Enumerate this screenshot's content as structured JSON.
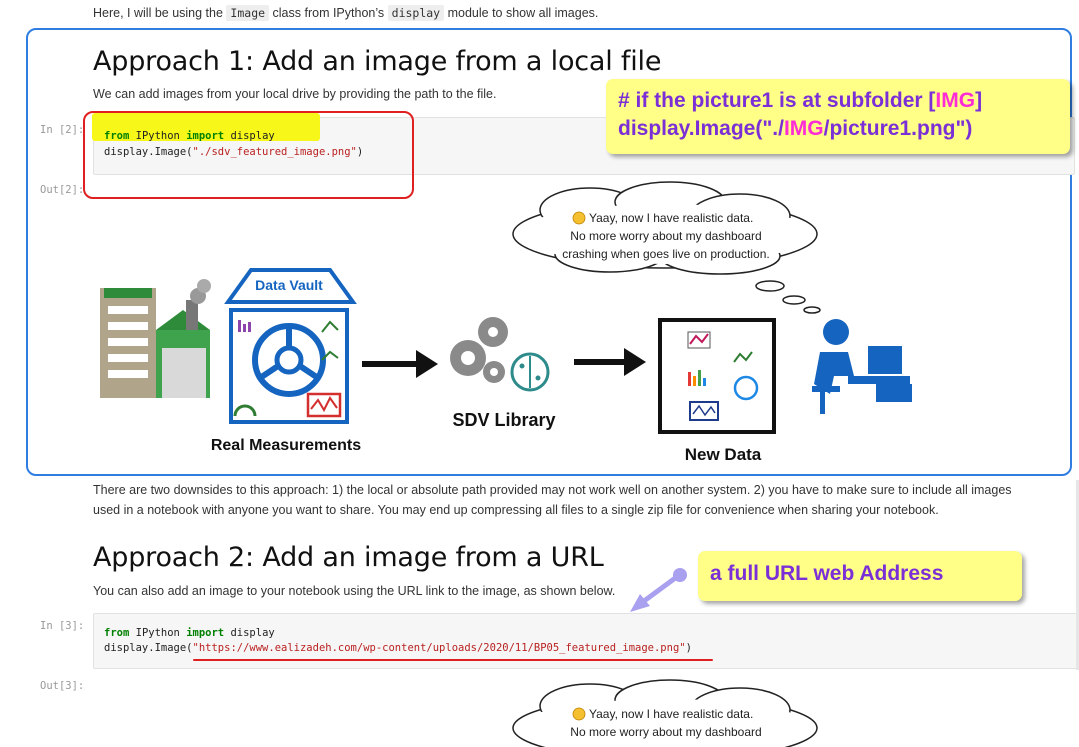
{
  "intro": {
    "before": "Here, I will be using the",
    "code1": "Image",
    "middle": "class from IPython’s",
    "code2": "display",
    "after": "module to show all images."
  },
  "approach1": {
    "title": "Approach 1: Add an image from a local file",
    "description": "We can add images from your local drive by providing the path to the file.",
    "in_prompt": "In [2]:",
    "out_prompt": "Out[2]:",
    "code_line1": {
      "kw1": "from",
      "mod": " IPython ",
      "kw2": "import",
      "rest": " display"
    },
    "code_line2": {
      "prefix": "display.Image(",
      "string": "\"./sdv_featured_image.png\"",
      "suffix": ")"
    }
  },
  "callout1": {
    "line1_prefix": "# if the picture1 is at subfolder [",
    "line1_highlight": "IMG",
    "line1_suffix": "]",
    "line2_prefix": "display.Image(\"./",
    "line2_highlight": "IMG",
    "line2_suffix": "/picture1.png\")"
  },
  "diagram": {
    "thought_line1": "Yaay, now I have realistic data.",
    "thought_line2": "No more worry about my dashboard",
    "thought_line3": "crashing when goes live on production.",
    "vault_label": "Data Vault",
    "real_label": "Real Measurements",
    "sdv_label": "SDV Library",
    "new_label": "New Data"
  },
  "downsides": {
    "line1": "There are two downsides to this approach: 1) the local or absolute path provided may not work well on another system. 2) you have to make sure to include all images",
    "line2": "used in a notebook with anyone you want to share. You may end up compressing all files to a single zip file for convenience when sharing your notebook."
  },
  "approach2": {
    "title": "Approach 2: Add an image from a URL",
    "description": "You can also add an image to your notebook using the URL link to the image, as shown below.",
    "in_prompt": "In [3]:",
    "out_prompt": "Out[3]:",
    "code_line1": {
      "kw1": "from",
      "mod": " IPython ",
      "kw2": "import",
      "rest": " display"
    },
    "code_line2": {
      "prefix": "display.Image(",
      "string": "\"https://www.ealizadeh.com/wp-content/uploads/2020/11/BP05_featured_image.png\"",
      "suffix": ")"
    }
  },
  "callout2": {
    "text": "a full URL web Address"
  },
  "diagram2": {
    "thought_line1": "Yaay, now I have realistic data.",
    "thought_line2": "No more worry about my dashboard"
  },
  "colors": {
    "blue_outline": "#2f7de1",
    "red_outline": "#e02020",
    "callout_bg": "#ffff88",
    "callout_text": "#7b2fd6",
    "callout_highlight": "#ff2bd6",
    "icon_blue": "#1565c0",
    "highlight_yellow": "#f7f71a"
  }
}
